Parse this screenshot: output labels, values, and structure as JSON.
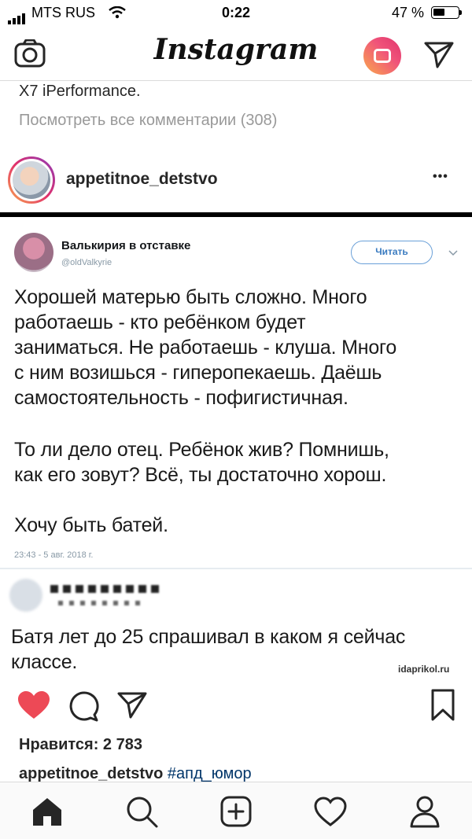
{
  "status": {
    "carrier": "MTS RUS",
    "time": "0:22",
    "battery": "47 %"
  },
  "header": {
    "logo": "Instagram"
  },
  "prev_post": {
    "caption_tail": "X7 iPerformance.",
    "view_comments": "Посмотреть все комментарии (308)"
  },
  "post": {
    "username": "appetitnoe_detstvo",
    "more": "•••",
    "tweet": {
      "author": "Валькирия в отставке",
      "handle": "@oldValkyrie",
      "follow": "Читать",
      "p1": [
        "Хорошей матерью быть сложно. Много",
        "работаешь - кто ребёнком будет",
        "заниматься. Не работаешь - клуша. Много",
        "с ним возишься - гиперопекаешь. Даёшь",
        "самостоятельность - пофигистичная."
      ],
      "p2": [
        "То ли дело отец. Ребёнок жив? Помнишь,",
        "как его зовут? Всё, ты достаточно хорош."
      ],
      "p3": "Хочу быть батей.",
      "date": "23:43 - 5 авг. 2018 г."
    },
    "reply": [
      "Батя лет до 25 спрашивал в каком я сейчас",
      "классе."
    ],
    "watermark": "idaprikol.ru",
    "likes": "Нравится: 2 783",
    "caption_user": "appetitnoe_detstvo",
    "caption_tag": "#апд_юмор"
  },
  "colors": {
    "like": "#ed4956",
    "link": "#003569"
  }
}
